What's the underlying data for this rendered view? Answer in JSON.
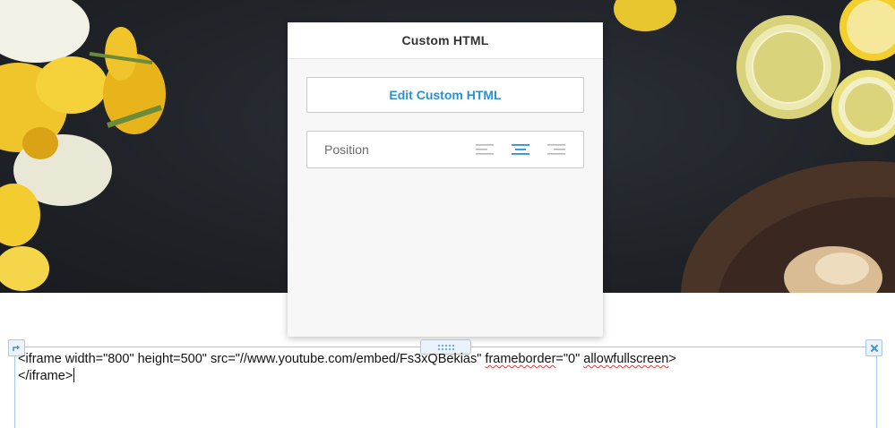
{
  "panel": {
    "title": "Custom HTML",
    "edit_button_label": "Edit Custom HTML",
    "position_label": "Position",
    "alignment_options": [
      "left-align",
      "center-align",
      "right-align"
    ],
    "selected_alignment": "center-align"
  },
  "editor": {
    "code_part1": "<iframe width=\"800\" height=500\" src=\"//www.youtube.com/embed/Fs3xQBekias\" ",
    "code_part2": "frameborder",
    "code_part3": "=\"0\" ",
    "code_part4": "allowfullscreen",
    "code_part5": ">",
    "code_line2": "</iframe>"
  },
  "colors": {
    "accent": "#2b8fd6",
    "border_blue": "#a7c9e8",
    "panel_bg": "#f7f7f7"
  },
  "icons": {
    "top_left": "arrow-corner-icon",
    "top_right": "close-icon",
    "handle": "drag-dots-icon"
  }
}
